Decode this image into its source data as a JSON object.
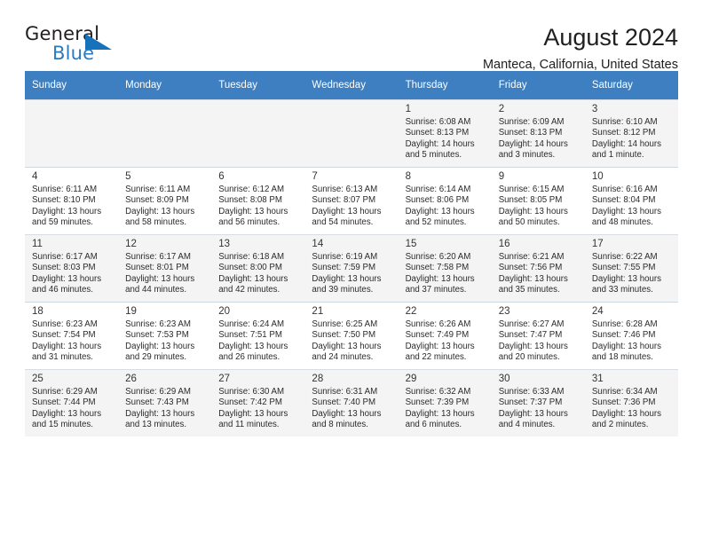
{
  "brand": {
    "name_top": "General",
    "name_bottom": "Blue",
    "triangle_color": "#1572bb",
    "blue_color": "#2a7ac0"
  },
  "header": {
    "title": "August 2024",
    "subtitle": "Manteca, California, United States",
    "header_bg": "#3d7fc1"
  },
  "weekdays": [
    "Sunday",
    "Monday",
    "Tuesday",
    "Wednesday",
    "Thursday",
    "Friday",
    "Saturday"
  ],
  "labels": {
    "sunrise": "Sunrise:",
    "sunset": "Sunset:",
    "daylight": "Daylight:"
  },
  "calendar_data": {
    "type": "table",
    "month": "August",
    "year": 2024,
    "location": "Manteca, California, United States",
    "first_day_of_week": "Sunday",
    "first_day_column_index": 4,
    "weeks": [
      [
        {
          "day": "",
          "sunrise": "",
          "sunset": "",
          "daylight_l1": "",
          "daylight_l2": ""
        },
        {
          "day": "",
          "sunrise": "",
          "sunset": "",
          "daylight_l1": "",
          "daylight_l2": ""
        },
        {
          "day": "",
          "sunrise": "",
          "sunset": "",
          "daylight_l1": "",
          "daylight_l2": ""
        },
        {
          "day": "",
          "sunrise": "",
          "sunset": "",
          "daylight_l1": "",
          "daylight_l2": ""
        },
        {
          "day": "1",
          "sunrise": "Sunrise: 6:08 AM",
          "sunset": "Sunset: 8:13 PM",
          "daylight_l1": "Daylight: 14 hours",
          "daylight_l2": "and 5 minutes."
        },
        {
          "day": "2",
          "sunrise": "Sunrise: 6:09 AM",
          "sunset": "Sunset: 8:13 PM",
          "daylight_l1": "Daylight: 14 hours",
          "daylight_l2": "and 3 minutes."
        },
        {
          "day": "3",
          "sunrise": "Sunrise: 6:10 AM",
          "sunset": "Sunset: 8:12 PM",
          "daylight_l1": "Daylight: 14 hours",
          "daylight_l2": "and 1 minute."
        }
      ],
      [
        {
          "day": "4",
          "sunrise": "Sunrise: 6:11 AM",
          "sunset": "Sunset: 8:10 PM",
          "daylight_l1": "Daylight: 13 hours",
          "daylight_l2": "and 59 minutes."
        },
        {
          "day": "5",
          "sunrise": "Sunrise: 6:11 AM",
          "sunset": "Sunset: 8:09 PM",
          "daylight_l1": "Daylight: 13 hours",
          "daylight_l2": "and 58 minutes."
        },
        {
          "day": "6",
          "sunrise": "Sunrise: 6:12 AM",
          "sunset": "Sunset: 8:08 PM",
          "daylight_l1": "Daylight: 13 hours",
          "daylight_l2": "and 56 minutes."
        },
        {
          "day": "7",
          "sunrise": "Sunrise: 6:13 AM",
          "sunset": "Sunset: 8:07 PM",
          "daylight_l1": "Daylight: 13 hours",
          "daylight_l2": "and 54 minutes."
        },
        {
          "day": "8",
          "sunrise": "Sunrise: 6:14 AM",
          "sunset": "Sunset: 8:06 PM",
          "daylight_l1": "Daylight: 13 hours",
          "daylight_l2": "and 52 minutes."
        },
        {
          "day": "9",
          "sunrise": "Sunrise: 6:15 AM",
          "sunset": "Sunset: 8:05 PM",
          "daylight_l1": "Daylight: 13 hours",
          "daylight_l2": "and 50 minutes."
        },
        {
          "day": "10",
          "sunrise": "Sunrise: 6:16 AM",
          "sunset": "Sunset: 8:04 PM",
          "daylight_l1": "Daylight: 13 hours",
          "daylight_l2": "and 48 minutes."
        }
      ],
      [
        {
          "day": "11",
          "sunrise": "Sunrise: 6:17 AM",
          "sunset": "Sunset: 8:03 PM",
          "daylight_l1": "Daylight: 13 hours",
          "daylight_l2": "and 46 minutes."
        },
        {
          "day": "12",
          "sunrise": "Sunrise: 6:17 AM",
          "sunset": "Sunset: 8:01 PM",
          "daylight_l1": "Daylight: 13 hours",
          "daylight_l2": "and 44 minutes."
        },
        {
          "day": "13",
          "sunrise": "Sunrise: 6:18 AM",
          "sunset": "Sunset: 8:00 PM",
          "daylight_l1": "Daylight: 13 hours",
          "daylight_l2": "and 42 minutes."
        },
        {
          "day": "14",
          "sunrise": "Sunrise: 6:19 AM",
          "sunset": "Sunset: 7:59 PM",
          "daylight_l1": "Daylight: 13 hours",
          "daylight_l2": "and 39 minutes."
        },
        {
          "day": "15",
          "sunrise": "Sunrise: 6:20 AM",
          "sunset": "Sunset: 7:58 PM",
          "daylight_l1": "Daylight: 13 hours",
          "daylight_l2": "and 37 minutes."
        },
        {
          "day": "16",
          "sunrise": "Sunrise: 6:21 AM",
          "sunset": "Sunset: 7:56 PM",
          "daylight_l1": "Daylight: 13 hours",
          "daylight_l2": "and 35 minutes."
        },
        {
          "day": "17",
          "sunrise": "Sunrise: 6:22 AM",
          "sunset": "Sunset: 7:55 PM",
          "daylight_l1": "Daylight: 13 hours",
          "daylight_l2": "and 33 minutes."
        }
      ],
      [
        {
          "day": "18",
          "sunrise": "Sunrise: 6:23 AM",
          "sunset": "Sunset: 7:54 PM",
          "daylight_l1": "Daylight: 13 hours",
          "daylight_l2": "and 31 minutes."
        },
        {
          "day": "19",
          "sunrise": "Sunrise: 6:23 AM",
          "sunset": "Sunset: 7:53 PM",
          "daylight_l1": "Daylight: 13 hours",
          "daylight_l2": "and 29 minutes."
        },
        {
          "day": "20",
          "sunrise": "Sunrise: 6:24 AM",
          "sunset": "Sunset: 7:51 PM",
          "daylight_l1": "Daylight: 13 hours",
          "daylight_l2": "and 26 minutes."
        },
        {
          "day": "21",
          "sunrise": "Sunrise: 6:25 AM",
          "sunset": "Sunset: 7:50 PM",
          "daylight_l1": "Daylight: 13 hours",
          "daylight_l2": "and 24 minutes."
        },
        {
          "day": "22",
          "sunrise": "Sunrise: 6:26 AM",
          "sunset": "Sunset: 7:49 PM",
          "daylight_l1": "Daylight: 13 hours",
          "daylight_l2": "and 22 minutes."
        },
        {
          "day": "23",
          "sunrise": "Sunrise: 6:27 AM",
          "sunset": "Sunset: 7:47 PM",
          "daylight_l1": "Daylight: 13 hours",
          "daylight_l2": "and 20 minutes."
        },
        {
          "day": "24",
          "sunrise": "Sunrise: 6:28 AM",
          "sunset": "Sunset: 7:46 PM",
          "daylight_l1": "Daylight: 13 hours",
          "daylight_l2": "and 18 minutes."
        }
      ],
      [
        {
          "day": "25",
          "sunrise": "Sunrise: 6:29 AM",
          "sunset": "Sunset: 7:44 PM",
          "daylight_l1": "Daylight: 13 hours",
          "daylight_l2": "and 15 minutes."
        },
        {
          "day": "26",
          "sunrise": "Sunrise: 6:29 AM",
          "sunset": "Sunset: 7:43 PM",
          "daylight_l1": "Daylight: 13 hours",
          "daylight_l2": "and 13 minutes."
        },
        {
          "day": "27",
          "sunrise": "Sunrise: 6:30 AM",
          "sunset": "Sunset: 7:42 PM",
          "daylight_l1": "Daylight: 13 hours",
          "daylight_l2": "and 11 minutes."
        },
        {
          "day": "28",
          "sunrise": "Sunrise: 6:31 AM",
          "sunset": "Sunset: 7:40 PM",
          "daylight_l1": "Daylight: 13 hours",
          "daylight_l2": "and 8 minutes."
        },
        {
          "day": "29",
          "sunrise": "Sunrise: 6:32 AM",
          "sunset": "Sunset: 7:39 PM",
          "daylight_l1": "Daylight: 13 hours",
          "daylight_l2": "and 6 minutes."
        },
        {
          "day": "30",
          "sunrise": "Sunrise: 6:33 AM",
          "sunset": "Sunset: 7:37 PM",
          "daylight_l1": "Daylight: 13 hours",
          "daylight_l2": "and 4 minutes."
        },
        {
          "day": "31",
          "sunrise": "Sunrise: 6:34 AM",
          "sunset": "Sunset: 7:36 PM",
          "daylight_l1": "Daylight: 13 hours",
          "daylight_l2": "and 2 minutes."
        }
      ]
    ]
  }
}
